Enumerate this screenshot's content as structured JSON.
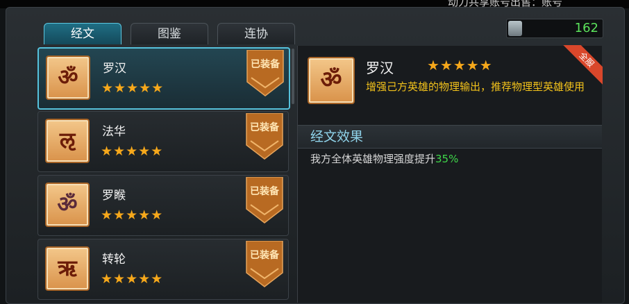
{
  "ticker": "动力共享账号出售：账号",
  "tabs": [
    {
      "label": "经文",
      "active": true
    },
    {
      "label": "图鉴",
      "active": false
    },
    {
      "label": "连协",
      "active": false
    }
  ],
  "counter": {
    "icon": "scroll-icon",
    "value": "162"
  },
  "equipped_label": "已装备",
  "star_text": "★★★★★",
  "list": [
    {
      "name": "罗汉",
      "stars": 5,
      "icon": "sutra-icon",
      "equipped": true,
      "selected": true
    },
    {
      "name": "法华",
      "stars": 5,
      "icon": "sutra-icon",
      "equipped": true,
      "selected": false
    },
    {
      "name": "罗睺",
      "stars": 5,
      "icon": "sutra-icon",
      "equipped": true,
      "selected": false
    },
    {
      "name": "转轮",
      "stars": 5,
      "icon": "sutra-icon",
      "equipped": true,
      "selected": false
    }
  ],
  "detail": {
    "name": "罗汉",
    "stars": 5,
    "ribbon": "全服",
    "description": "增强己方英雄的物理输出，推荐物理型英雄使用",
    "section_title": "经文效果",
    "effect_prefix": "我方全体英雄物理强度提升",
    "effect_value": "35%"
  },
  "colors": {
    "accent_tab": "#1f6e84",
    "star": "#f6a81b",
    "description": "#f2c21b",
    "effect_value": "#3fd84a",
    "counter_value": "#5be35b"
  }
}
